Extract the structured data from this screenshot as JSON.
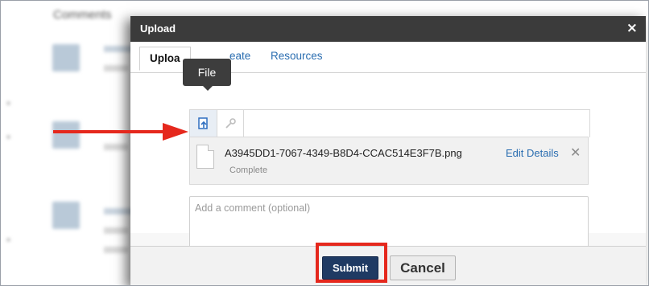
{
  "background": {
    "section_title": "Comments"
  },
  "dialog": {
    "title": "Upload",
    "close_glyph": "×",
    "tabs": [
      {
        "label": "Upload",
        "active": true
      },
      {
        "label": "Create",
        "active": false
      },
      {
        "label": "Resources",
        "active": false
      }
    ],
    "tabs_visible": {
      "upload": "Uploa",
      "create": "eate",
      "resources": "Resources"
    },
    "tooltip": "File",
    "toolbar": {
      "file_icon": "file-upload-icon",
      "link_icon": "link-icon"
    },
    "attachment": {
      "file_name": "A3945DD1-7067-4349-B8D4-CCAC514E3F7B.png",
      "status": "Complete",
      "edit_label": "Edit Details",
      "remove_glyph": "✕"
    },
    "comment_placeholder": "Add a comment (optional)",
    "submit_label": "Submit",
    "cancel_label": "Cancel"
  },
  "annotations": {
    "accent_color": "#e5281d",
    "arrow_points_to": "attachment",
    "box_highlights": "submit"
  },
  "colors": {
    "titlebar": "#3b3b3b",
    "link": "#2a6db0",
    "submit": "#1f3a63"
  }
}
